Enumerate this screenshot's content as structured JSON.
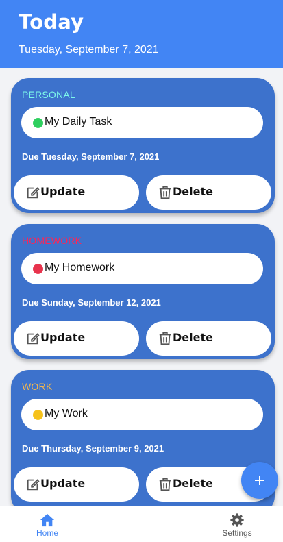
{
  "header": {
    "title": "Today",
    "date": "Tuesday, September 7, 2021"
  },
  "tasks": [
    {
      "category": "PERSONAL",
      "category_color": "#7cf7ea",
      "name": "My Daily Task",
      "dot_color": "#2fcf5f",
      "due": "Due Tuesday, September 7, 2021",
      "update_label": "Update",
      "delete_label": "Delete"
    },
    {
      "category": "HOMEWORK",
      "category_color": "#ff2455",
      "name": "My Homework",
      "dot_color": "#e8334d",
      "due": "Due Sunday, September 12, 2021",
      "update_label": "Update",
      "delete_label": "Delete"
    },
    {
      "category": "WORK",
      "category_color": "#f7b84b",
      "name": "My Work",
      "dot_color": "#f6c21b",
      "due": "Due Thursday, September 9, 2021",
      "update_label": "Update",
      "delete_label": "Delete"
    }
  ],
  "fab": {
    "icon": "plus-icon"
  },
  "nav": {
    "home_label": "Home",
    "settings_label": "Settings",
    "active_color": "#4285f4"
  },
  "colors": {
    "header_bg": "#4285f4",
    "card_bg": "#3d72cc",
    "page_bg": "#f2f3f6"
  }
}
